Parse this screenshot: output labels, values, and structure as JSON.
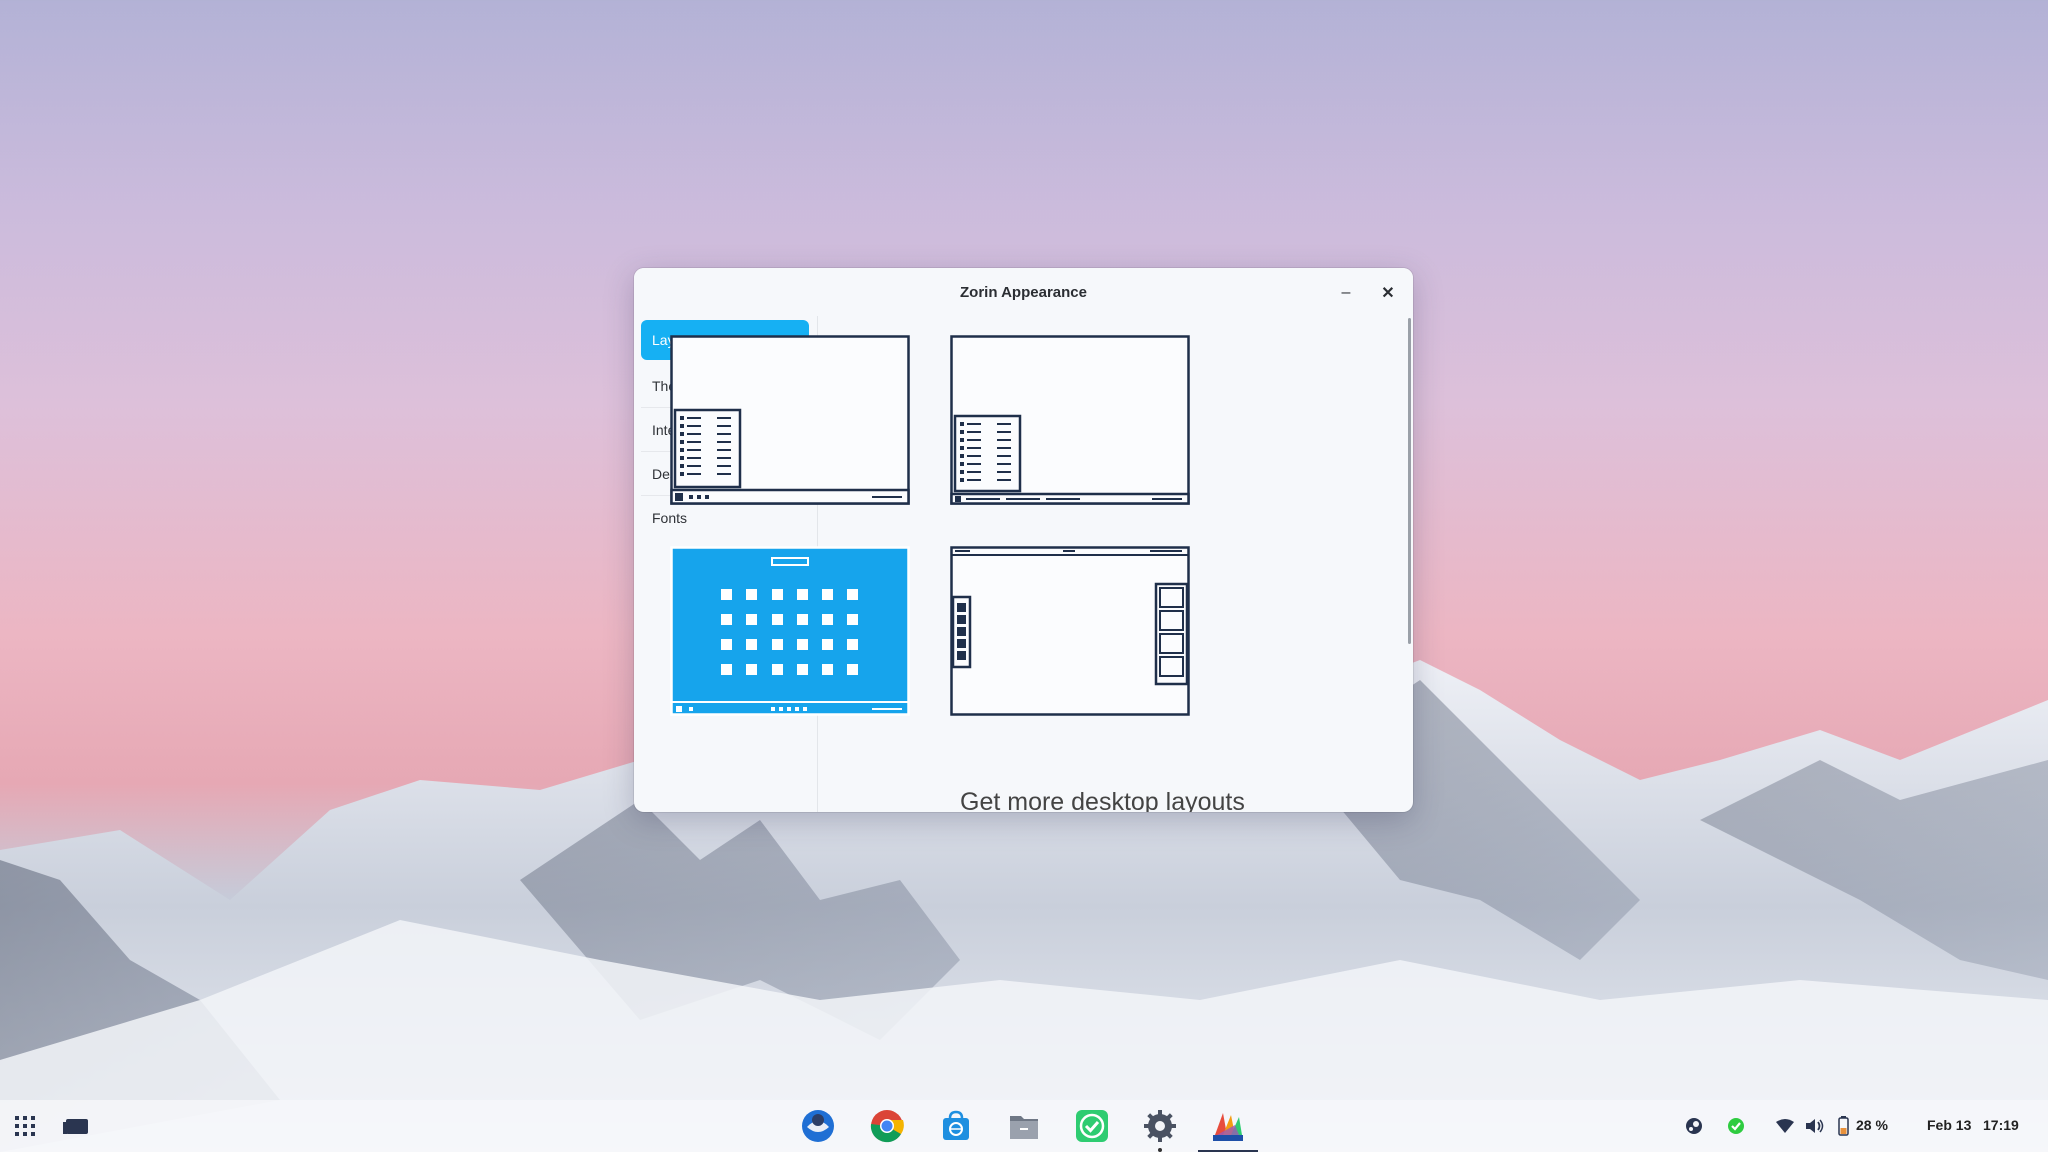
{
  "window": {
    "title": "Zorin Appearance",
    "minimize_label": "–",
    "close_label": "✕"
  },
  "sidebar": {
    "items": [
      {
        "label": "Layout",
        "active": true
      },
      {
        "label": "Theme",
        "active": false
      },
      {
        "label": "Interface",
        "active": false
      },
      {
        "label": "Desktop",
        "active": false
      },
      {
        "label": "Fonts",
        "active": false
      }
    ]
  },
  "layouts": {
    "selected_index": 2,
    "more_link": "Get more desktop layouts"
  },
  "taskbar": {
    "left_icons": [
      "app-grid-icon",
      "workspace-switcher-icon"
    ],
    "apps": [
      "thunderbird-icon",
      "chrome-icon",
      "software-store-icon",
      "files-icon",
      "task-checker-icon",
      "settings-icon",
      "zorin-appearance-icon"
    ],
    "tray": {
      "icons": [
        "steam-icon",
        "check-shield-icon",
        "wifi-icon",
        "volume-icon",
        "battery-icon"
      ],
      "battery": "28 %",
      "date": "Feb 13",
      "time": "17:19"
    }
  },
  "colors": {
    "accent": "#16b0f3",
    "window_bg": "#f6f8fb",
    "line": "#1f2f4a"
  }
}
